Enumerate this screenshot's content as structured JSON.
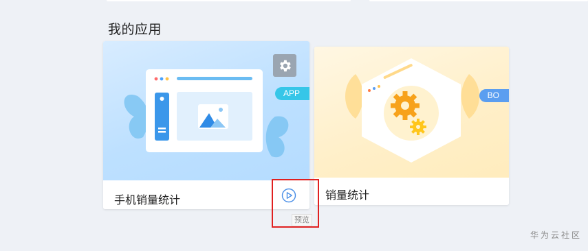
{
  "section": {
    "title": "我的应用"
  },
  "apps": [
    {
      "name": "手机销量统计",
      "badge": "APP",
      "accent": "#36c6e8"
    },
    {
      "name": "销量统计",
      "badge": "BO",
      "accent": "#5b9ef0"
    }
  ],
  "preview_tooltip": "预览",
  "watermark": "华为云社区",
  "icons": {
    "settings": "gear-icon",
    "preview": "play-circle-icon"
  }
}
